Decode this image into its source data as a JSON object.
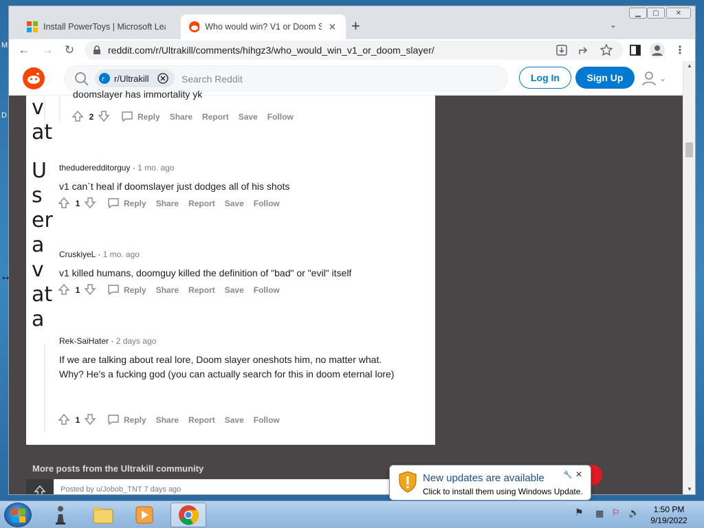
{
  "desktop": {
    "left_letters": [
      "M",
      "D"
    ]
  },
  "browser": {
    "tabs": [
      {
        "title": "Install PowerToys | Microsoft Lear",
        "active": false
      },
      {
        "title": "Who would win? V1 or Doom Slay",
        "active": true
      }
    ],
    "new_tab": "+",
    "address": "reddit.com/r/Ultrakill/comments/hihgz3/who_would_win_v1_or_doom_slayer/"
  },
  "reddit": {
    "search_chip": "r/Ultrakill",
    "search_placeholder": "Search Reddit",
    "login": "Log In",
    "signup": "Sign Up",
    "partial_comment_text": "doomslayer has immortality yk",
    "partial_comment_votes": "2",
    "broken_avatar_text": [
      "v",
      "at",
      "U",
      "s",
      "er",
      "a",
      "v",
      "at",
      "a"
    ],
    "actions": {
      "reply": "Reply",
      "share": "Share",
      "report": "Report",
      "save": "Save",
      "follow": "Follow"
    },
    "comments": [
      {
        "author": "thedudereddit­orguy",
        "age": "1 mo. ago",
        "text": [
          "v1 can`t heal if doomslayer just dodges all of his shots"
        ],
        "votes": "1"
      },
      {
        "author": "CruskiyeL",
        "age": "1 mo. ago",
        "text": [
          "v1 killed humans, doomguy killed the definition of \"bad\" or \"evil\" itself"
        ],
        "votes": "1"
      },
      {
        "author": "Rek-SaiHater",
        "age": "2 days ago",
        "text": [
          "If we are talking about real lore, Doom slayer oneshots him, no matter what.",
          "Why? He's a fucking god (you can actually search for this in doom eternal lore)"
        ],
        "votes": "1"
      }
    ],
    "more_posts": "More posts from the Ultrakill community",
    "posted_by": "Posted by u/Jobob_TNT 7 days ago"
  },
  "notification": {
    "title": "New updates are available",
    "body": "Click to install them using Windows Update."
  },
  "taskbar": {
    "time": "1:50 PM",
    "date": "9/19/2022"
  }
}
